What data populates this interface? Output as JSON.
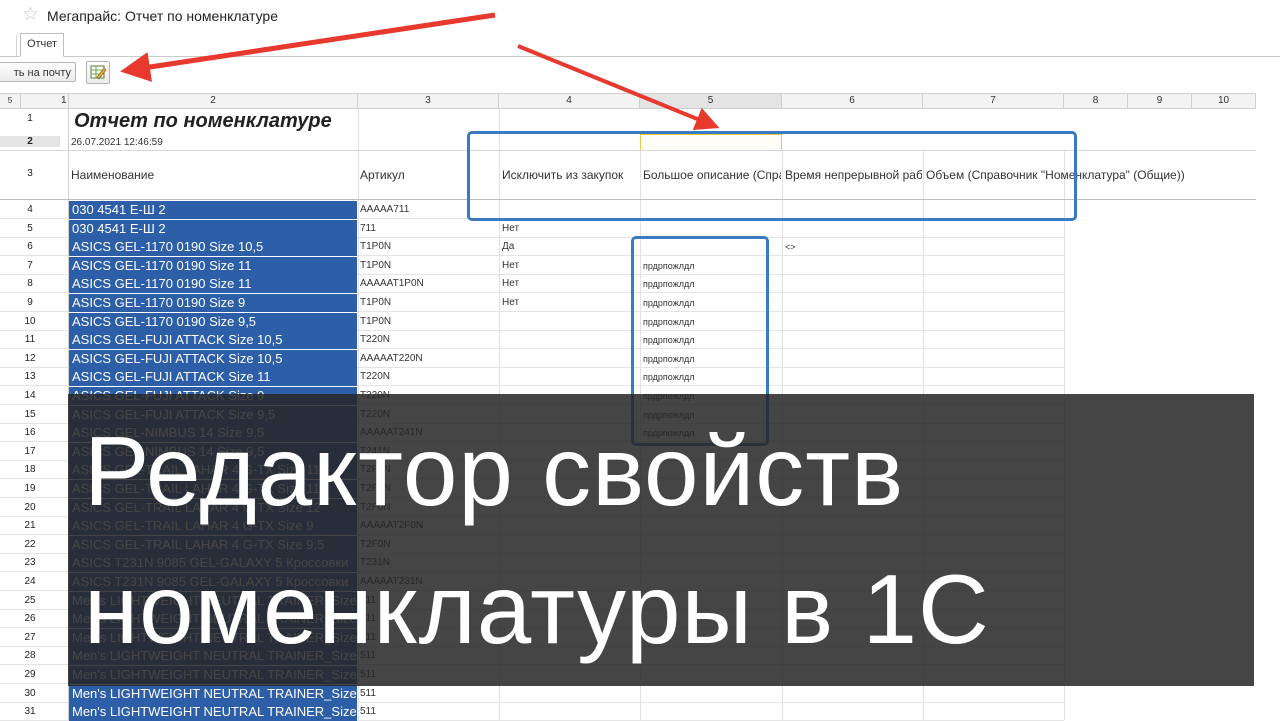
{
  "window": {
    "title": "Мегапрайс: Отчет по номенклатуре"
  },
  "tabs": [
    {
      "label": "Отчет"
    }
  ],
  "toolbar": {
    "mail_label": "ть на почту"
  },
  "sheet": {
    "col_headers": [
      "5",
      "1",
      "2",
      "3",
      "4",
      "5",
      "6",
      "7",
      "8",
      "9",
      "10"
    ],
    "report_title": "Отчет по номенклатуре",
    "report_date": "26.07.2021 12:46:59",
    "row_labels_top": [
      "1",
      "2",
      "3"
    ],
    "headers": {
      "name": "Наименование",
      "article": "Артикул",
      "exclude": "Исключить из закупок",
      "description": "Большое описание (Спра",
      "time": "Время непрерывной рабо",
      "volume": "Объем (Справочник \"Номенклатура\" (Общие))"
    },
    "rows": [
      {
        "n": "4",
        "name": "030 4541 Е-Ш 2",
        "art": "AAAAA711",
        "exc": "",
        "desc": "",
        "time": ""
      },
      {
        "n": "5",
        "name": "030 4541 Е-Ш 2",
        "art": "711",
        "exc": "Нет",
        "desc": "",
        "time": ""
      },
      {
        "n": "6",
        "name": "ASICS GEL-1170 0190 Size 10,5",
        "art": "T1P0N",
        "exc": "Да",
        "desc": "",
        "time": "<>"
      },
      {
        "n": "7",
        "name": "ASICS GEL-1170 0190 Size 11",
        "art": "T1P0N",
        "exc": "Нет",
        "desc": "прдрпожлдл",
        "time": ""
      },
      {
        "n": "8",
        "name": "ASICS GEL-1170 0190 Size 11",
        "art": "AAAAAT1P0N",
        "exc": "Нет",
        "desc": "прдрпожлдл",
        "time": ""
      },
      {
        "n": "9",
        "name": "ASICS GEL-1170 0190 Size 9",
        "art": "T1P0N",
        "exc": "Нет",
        "desc": "прдрпожлдл",
        "time": ""
      },
      {
        "n": "10",
        "name": "ASICS GEL-1170 0190 Size 9,5",
        "art": "T1P0N",
        "exc": "",
        "desc": "прдрпожлдл",
        "time": ""
      },
      {
        "n": "11",
        "name": "ASICS GEL-FUJI ATTACK Size 10,5",
        "art": "T220N",
        "exc": "",
        "desc": "прдрпожлдл",
        "time": ""
      },
      {
        "n": "12",
        "name": "ASICS GEL-FUJI ATTACK Size 10,5",
        "art": "AAAAAT220N",
        "exc": "",
        "desc": "прдрпожлдл",
        "time": ""
      },
      {
        "n": "13",
        "name": "ASICS GEL-FUJI ATTACK Size 11",
        "art": "T220N",
        "exc": "",
        "desc": "прдрпожлдл",
        "time": ""
      },
      {
        "n": "14",
        "name": "ASICS GEL-FUJI ATTACK Size 9",
        "art": "T220N",
        "exc": "",
        "desc": "прдрпожлдл",
        "time": ""
      },
      {
        "n": "15",
        "name": "ASICS GEL-FUJI ATTACK Size 9,5",
        "art": "T220N",
        "exc": "",
        "desc": "прдрпожлдл",
        "time": ""
      },
      {
        "n": "16",
        "name": "ASICS GEL-NIMBUS 14 Size 9,5",
        "art": "AAAAAT241N",
        "exc": "",
        "desc": "прдрпожлдл",
        "time": ""
      },
      {
        "n": "17",
        "name": "ASICS GEL-NIMBUS 14 Size 9,5",
        "art": "T241N",
        "exc": "",
        "desc": "",
        "time": ""
      },
      {
        "n": "18",
        "name": "ASICS GEL-TRAIL LAHAR 4 G-TX Size 11",
        "art": "T2F0N",
        "exc": "",
        "desc": "",
        "time": ""
      },
      {
        "n": "19",
        "name": "ASICS GEL-TRAIL LAHAR 4 G-TX Size 11",
        "art": "T2F0N",
        "exc": "",
        "desc": "",
        "time": ""
      },
      {
        "n": "20",
        "name": "ASICS GEL-TRAIL LAHAR 4 G-TX Size 12",
        "art": "T2F0N",
        "exc": "",
        "desc": "",
        "time": ""
      },
      {
        "n": "21",
        "name": "ASICS GEL-TRAIL LAHAR 4 G-TX Size 9",
        "art": "AAAAAT2F0N",
        "exc": "",
        "desc": "",
        "time": ""
      },
      {
        "n": "22",
        "name": "ASICS GEL-TRAIL LAHAR 4 G-TX Size 9,5",
        "art": "T2F0N",
        "exc": "",
        "desc": "",
        "time": ""
      },
      {
        "n": "23",
        "name": "ASICS T231N 9085 GEL-GALAXY 5 Кроссовки",
        "art": "T231N",
        "exc": "",
        "desc": "",
        "time": ""
      },
      {
        "n": "24",
        "name": "ASICS T231N 9085 GEL-GALAXY 5 Кроссовки",
        "art": "AAAAAT231N",
        "exc": "",
        "desc": "",
        "time": ""
      },
      {
        "n": "25",
        "name": "Men's LIGHTWEIGHT NEUTRAL TRAINER_Size",
        "art": "511",
        "exc": "",
        "desc": "",
        "time": ""
      },
      {
        "n": "26",
        "name": "Men's LIGHTWEIGHT NEUTRAL TRAINER_Size",
        "art": "511",
        "exc": "",
        "desc": "",
        "time": ""
      },
      {
        "n": "27",
        "name": "Men's LIGHTWEIGHT NEUTRAL TRAINER_Size",
        "art": "511",
        "exc": "",
        "desc": "",
        "time": ""
      },
      {
        "n": "28",
        "name": "Men's LIGHTWEIGHT NEUTRAL TRAINER_Size",
        "art": "511",
        "exc": "",
        "desc": "",
        "time": ""
      },
      {
        "n": "29",
        "name": "Men's LIGHTWEIGHT NEUTRAL TRAINER_Size",
        "art": "511",
        "exc": "",
        "desc": "",
        "time": ""
      },
      {
        "n": "30",
        "name": "Men's LIGHTWEIGHT NEUTRAL TRAINER_Size",
        "art": "511",
        "exc": "",
        "desc": "",
        "time": ""
      },
      {
        "n": "31",
        "name": "Men's LIGHTWEIGHT NEUTRAL TRAINER_Size",
        "art": "511",
        "exc": "",
        "desc": "",
        "time": ""
      }
    ]
  },
  "overlay": {
    "line1": "Редактор свойств",
    "line2": "номенклатуры в 1С"
  },
  "colors": {
    "selection": "#2d5ea8",
    "highlight_box": "#3a7ac0",
    "arrow": "#e8392e",
    "overlay_bg": "#262626"
  }
}
